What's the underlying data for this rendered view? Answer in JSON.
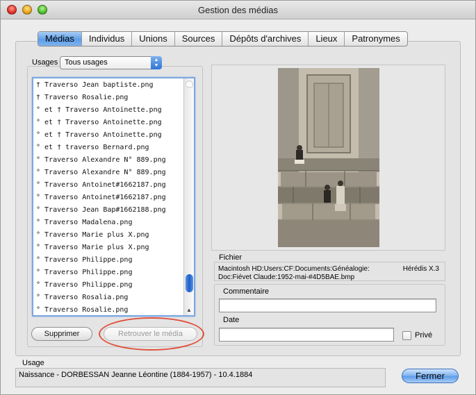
{
  "window": {
    "title": "Gestion des médias"
  },
  "tabs": [
    {
      "label": "Médias",
      "active": true
    },
    {
      "label": "Individus"
    },
    {
      "label": "Unions"
    },
    {
      "label": "Sources"
    },
    {
      "label": "Dépôts d'archives"
    },
    {
      "label": "Lieux"
    },
    {
      "label": "Patronymes"
    }
  ],
  "usages": {
    "label": "Usages",
    "selected": "Tous usages"
  },
  "file_list": {
    "items": [
      "† Traverso Jean baptiste.png",
      "† Traverso Rosalie.png",
      "° et † Traverso Antoinette.png",
      "° et † Traverso Antoinette.png",
      "° et † Traverso Antoinette.png",
      "° et † traverso Bernard.png",
      "° Traverso Alexandre N° 889.png",
      "° Traverso Alexandre N° 889.png",
      "° Traverso Antoinet#1662187.png",
      "° Traverso Antoinet#1662187.png",
      "° Traverso Jean Bap#1662188.png",
      "° Traverso Madalena.png",
      "° Traverso Marie plus X.png",
      "° Traverso Marie plus X.png",
      "° Traverso Philippe.png",
      "° Traverso Philippe.png",
      "° Traverso Philippe.png",
      "° Traverso Rosalia.png",
      "° Traverso Rosalie.png"
    ]
  },
  "buttons": {
    "delete": "Supprimer",
    "recover": "Retrouver le média",
    "close": "Fermer"
  },
  "fichier": {
    "label": "Fichier",
    "path": "Macintosh HD:Users:CF:Documents:Généalogie: Doc:Fiévet Claude:1952-mai-#4D5BAE.bmp",
    "app": "Hérédis X.3"
  },
  "commentaire": {
    "label": "Commentaire",
    "value": ""
  },
  "date": {
    "label": "Date",
    "value": ""
  },
  "prive": {
    "label": "Privé",
    "checked": false
  },
  "usage": {
    "label": "Usage",
    "text": "Naissance - DORBESSAN Jeanne Léontine (1884-1957) - 10.4.1884"
  },
  "colors": {
    "accent": "#5e9ee8",
    "highlight": "#e0513c"
  },
  "icons": {
    "close": "close-window-icon",
    "minimize": "minimize-window-icon",
    "zoom": "zoom-window-icon"
  }
}
